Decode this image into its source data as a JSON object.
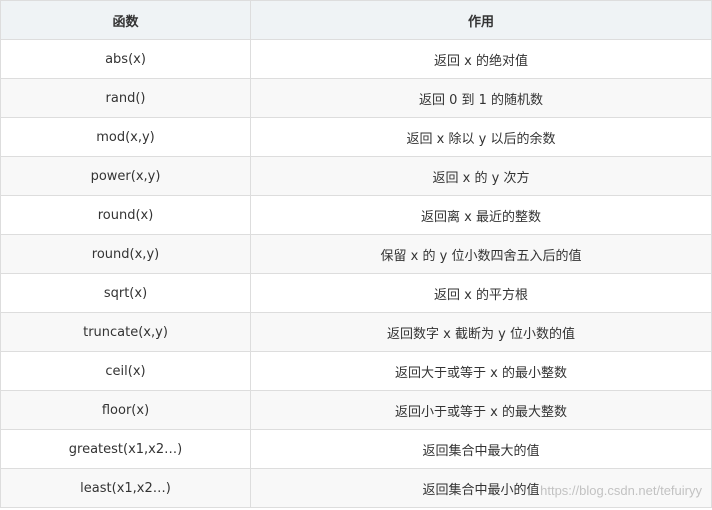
{
  "table": {
    "headers": [
      "函数",
      "作用"
    ],
    "rows": [
      [
        "abs(x)",
        "返回 x 的绝对值"
      ],
      [
        "rand()",
        "返回 0 到 1 的随机数"
      ],
      [
        "mod(x,y)",
        "返回 x 除以 y 以后的余数"
      ],
      [
        "power(x,y)",
        "返回 x 的 y 次方"
      ],
      [
        "round(x)",
        "返回离 x 最近的整数"
      ],
      [
        "round(x,y)",
        "保留 x 的 y 位小数四舍五入后的值"
      ],
      [
        "sqrt(x)",
        "返回 x 的平方根"
      ],
      [
        "truncate(x,y)",
        "返回数字 x 截断为 y 位小数的值"
      ],
      [
        "ceil(x)",
        "返回大于或等于 x 的最小整数"
      ],
      [
        "floor(x)",
        "返回小于或等于 x 的最大整数"
      ],
      [
        "greatest(x1,x2…)",
        "返回集合中最大的值"
      ],
      [
        "least(x1,x2…)",
        "返回集合中最小的值"
      ]
    ]
  },
  "watermark": "https://blog.csdn.net/tefuiryy"
}
